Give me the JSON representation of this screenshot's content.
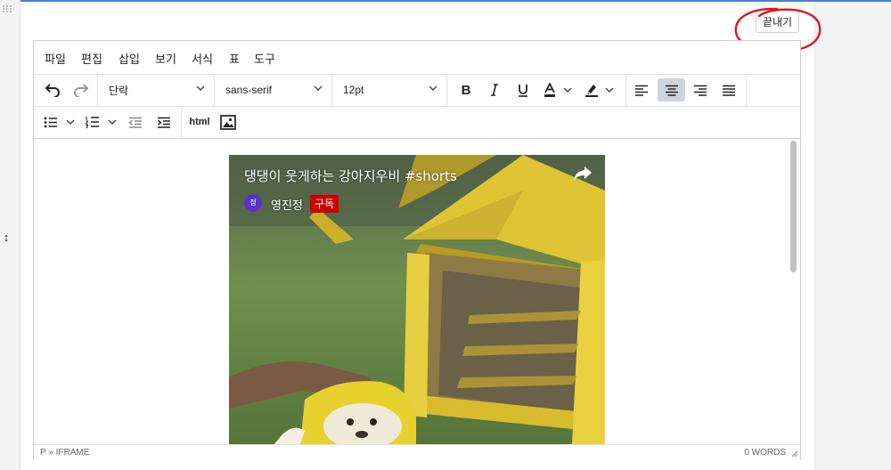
{
  "toolbar_top": {
    "finish_label": "끝내기"
  },
  "menubar": [
    "파일",
    "편집",
    "삽입",
    "보기",
    "서식",
    "표",
    "도구"
  ],
  "toolbar": {
    "block_format": "단락",
    "font_family": "sans-serif",
    "font_size": "12pt",
    "html_label": "html"
  },
  "video": {
    "title": "댕댕이 웃게하는 강아지우비 #shorts",
    "channel_initial": "정",
    "channel_name": "영진정",
    "subscribe_label": "구독"
  },
  "statusbar": {
    "path": "P » IFRAME",
    "word_count": "0 WORDS"
  },
  "colors": {
    "accent_line": "#4a7fd6",
    "annotation_circle": "#e0141e",
    "subscribe": "#cc0000",
    "avatar": "#5b33c9",
    "active_button": "#ced5de"
  }
}
